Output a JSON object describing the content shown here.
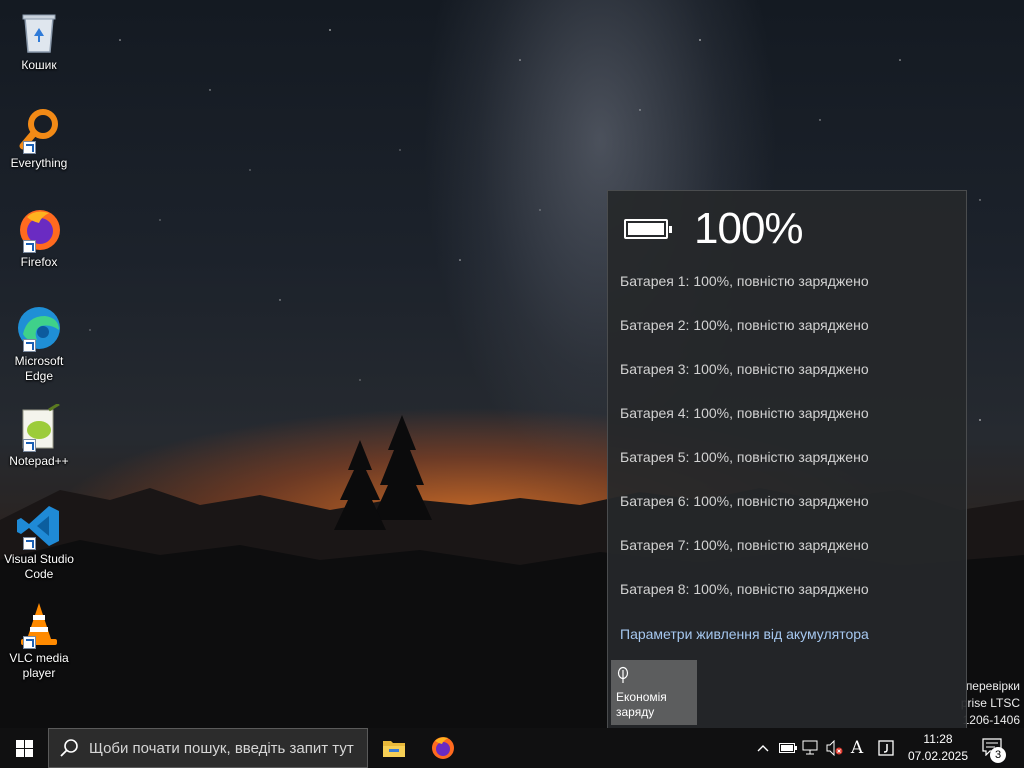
{
  "desktop": {
    "icons": [
      {
        "label": "Кошик"
      },
      {
        "label": "Everything"
      },
      {
        "label": "Firefox"
      },
      {
        "label": "Microsoft Edge"
      },
      {
        "label": "Notepad++"
      },
      {
        "label": "Visual Studio Code"
      },
      {
        "label": "VLC media player"
      }
    ],
    "watermark": {
      "line1": "перевірки",
      "line2": "prise LTSC",
      "line3": "1206-1406"
    }
  },
  "flyout": {
    "percent": "100%",
    "level": 1.0,
    "batteries": [
      "Батарея 1: 100%, повністю заряджено",
      "Батарея 2: 100%, повністю заряджено",
      "Батарея 3: 100%, повністю заряджено",
      "Батарея 4: 100%, повністю заряджено",
      "Батарея 5: 100%, повністю заряджено",
      "Батарея 6: 100%, повністю заряджено",
      "Батарея 7: 100%, повністю заряджено",
      "Батарея 8: 100%, повністю заряджено"
    ],
    "settings_link": "Параметри живлення від акумулятора",
    "saver": {
      "line1": "Економія",
      "line2": "заряду"
    }
  },
  "taskbar": {
    "search_placeholder": "Щоби почати пошук, введіть запит тут",
    "language": "A",
    "time": "11:28",
    "date": "07.02.2025",
    "notification_count": "3"
  },
  "colors": {
    "link": "#a6c8f0",
    "taskbar": "#101011",
    "flyout_bg": "#26282a",
    "saver_tile": "#5c5d5e"
  }
}
